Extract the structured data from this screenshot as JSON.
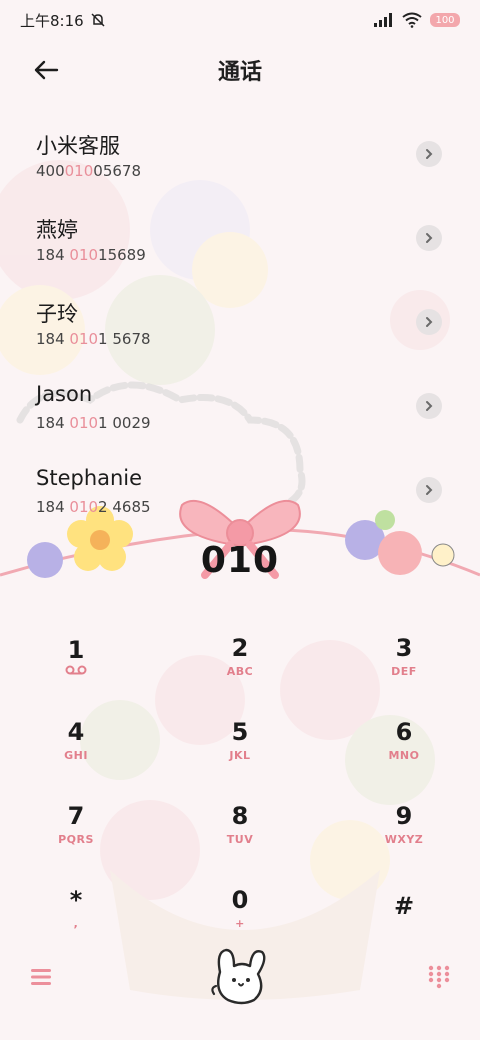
{
  "status_bar": {
    "time": "上午8:16",
    "battery": "100"
  },
  "header": {
    "title": "通话"
  },
  "contacts": [
    {
      "name": "小米客服",
      "num_pre": "400",
      "num_hl": "010",
      "num_post": "05678"
    },
    {
      "name": "燕婷",
      "num_pre": "184 ",
      "num_hl": "010",
      "num_post": "15689"
    },
    {
      "name": "子玲",
      "num_pre": "184 ",
      "num_hl": "010",
      "num_post": "1 5678"
    },
    {
      "name": "Jason",
      "num_pre": "184 ",
      "num_hl": "010",
      "num_post": "1 0029"
    },
    {
      "name": "Stephanie",
      "num_pre": "184 ",
      "num_hl": "010",
      "num_post": "2 4685"
    }
  ],
  "dial": {
    "number": "010"
  },
  "keypad": [
    {
      "digit": "1",
      "letters": "voicemail",
      "icon": "voicemail-icon"
    },
    {
      "digit": "2",
      "letters": "ABC"
    },
    {
      "digit": "3",
      "letters": "DEF"
    },
    {
      "digit": "4",
      "letters": "GHI"
    },
    {
      "digit": "5",
      "letters": "JKL"
    },
    {
      "digit": "6",
      "letters": "MNO"
    },
    {
      "digit": "7",
      "letters": "PQRS"
    },
    {
      "digit": "8",
      "letters": "TUV"
    },
    {
      "digit": "9",
      "letters": "WXYZ"
    },
    {
      "digit": "*",
      "letters": ","
    },
    {
      "digit": "0",
      "letters": "+"
    },
    {
      "digit": "#",
      "letters": ""
    }
  ],
  "colors": {
    "accent": "#e98f9a",
    "background": "#fbf4f5",
    "chevron_bg": "#e6e2e3"
  }
}
